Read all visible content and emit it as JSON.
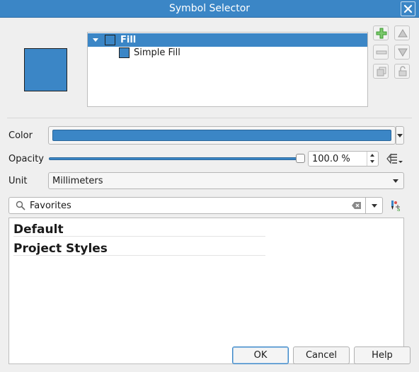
{
  "window": {
    "title": "Symbol Selector"
  },
  "colors": {
    "accent": "#3b86c6",
    "symbol_fill": "#3b86c6",
    "plus_green": "#3a9a2f"
  },
  "layers_tree": {
    "items": [
      {
        "label": "Fill",
        "selected": true,
        "expanded": true
      },
      {
        "label": "Simple Fill",
        "selected": false
      }
    ]
  },
  "side_buttons": [
    "add-layer",
    "move-up",
    "remove-layer",
    "move-down",
    "duplicate-layer",
    "lock-layer"
  ],
  "properties": {
    "color_label": "Color",
    "opacity_label": "Opacity",
    "opacity_value": "100.0 %",
    "opacity_fraction": 1.0,
    "unit_label": "Unit",
    "unit_value": "Millimeters"
  },
  "search": {
    "value": "Favorites"
  },
  "style_groups": [
    "Default",
    "Project Styles"
  ],
  "buttons": {
    "ok": "OK",
    "cancel": "Cancel",
    "help": "Help"
  }
}
